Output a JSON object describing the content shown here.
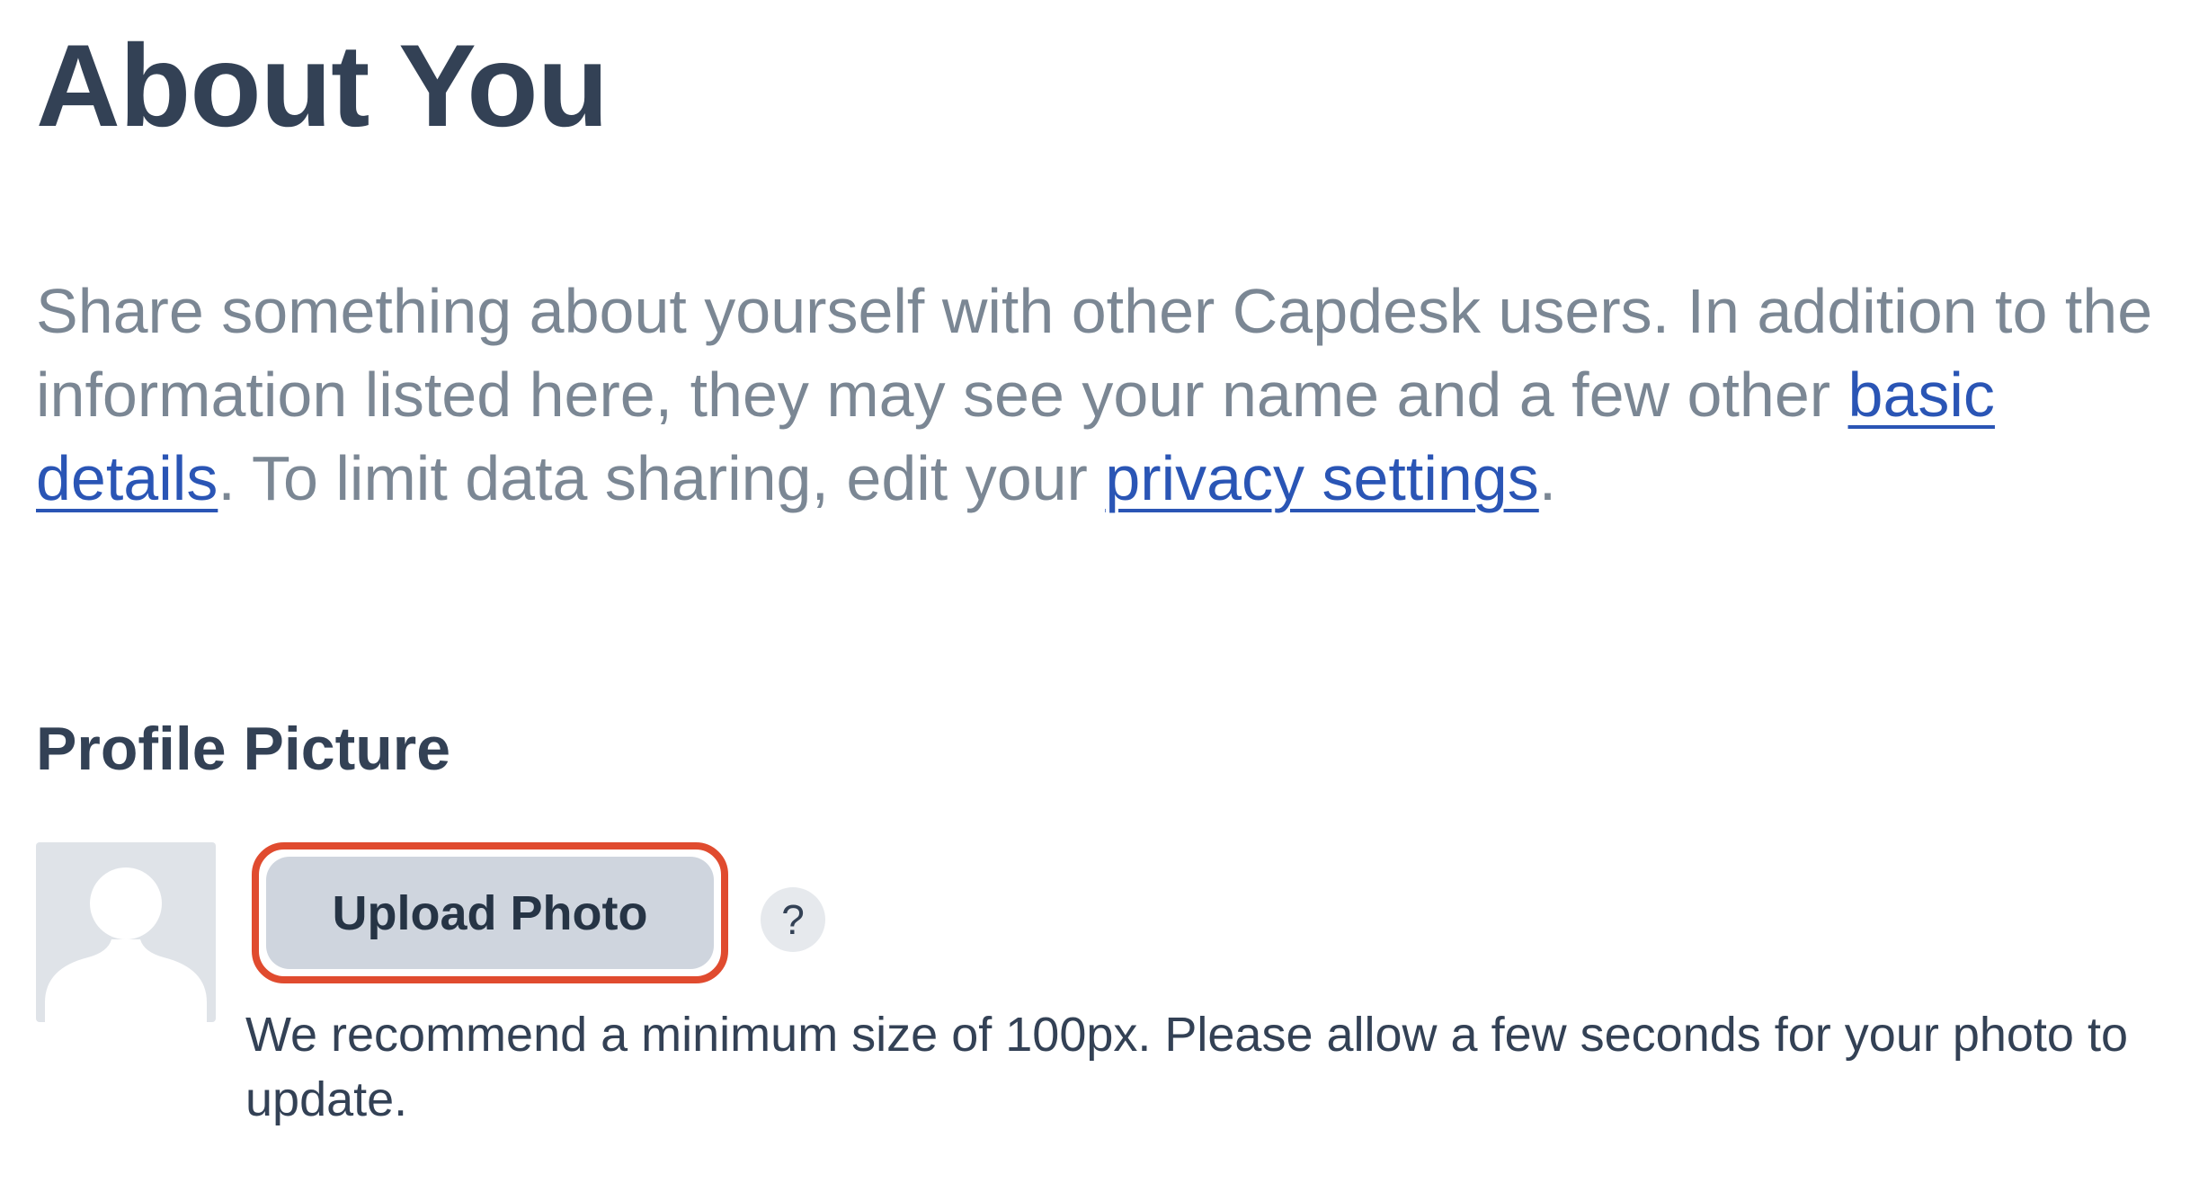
{
  "header": {
    "title": "About You"
  },
  "intro": {
    "text_1": "Share something about yourself with other Capdesk users. In addition to the information listed here, they may see your name and a few other ",
    "link_basic_details": "basic details",
    "text_2": ". To limit data sharing, edit your ",
    "link_privacy_settings": "privacy settings",
    "text_3": "."
  },
  "profile_picture": {
    "section_title": "Profile Picture",
    "avatar_icon": "person-silhouette-icon",
    "upload_label": "Upload Photo",
    "help_label": "?",
    "help_text": "We recommend a minimum size of 100px. Please allow a few seconds for your photo to update."
  },
  "colors": {
    "heading": "#334155",
    "body_text": "#7b8794",
    "link": "#2a55b5",
    "highlight_border": "#e04b2f",
    "button_bg": "#cfd5de",
    "avatar_bg": "#dfe3e8"
  }
}
